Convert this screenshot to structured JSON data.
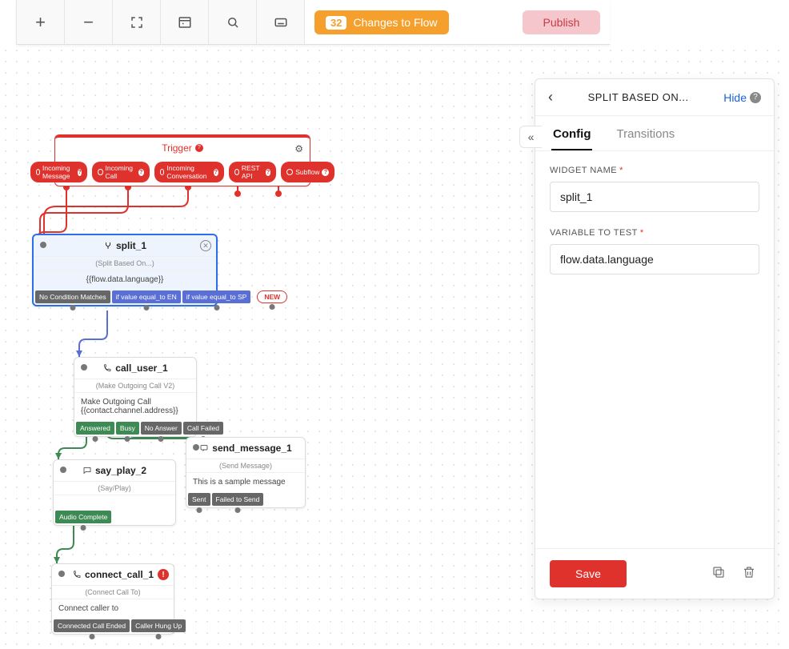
{
  "toolbar": {
    "changes_count": "32",
    "changes_label": "Changes to Flow",
    "publish_label": "Publish"
  },
  "trigger": {
    "title": "Trigger",
    "outputs": [
      "Incoming Message",
      "Incoming Call",
      "Incoming Conversation",
      "REST API",
      "Subflow"
    ]
  },
  "split_1": {
    "title": "split_1",
    "subtitle": "(Split Based On...)",
    "body": "{{flow.data.language}}",
    "outputs": {
      "no_match": "No Condition Matches",
      "en": "if value equal_to EN",
      "sp": "if value equal_to SP",
      "new": "NEW"
    }
  },
  "call_user_1": {
    "title": "call_user_1",
    "subtitle": "(Make Outgoing Call V2)",
    "body_line1": "Make Outgoing Call",
    "body_line2": "{{contact.channel.address}}",
    "outputs": {
      "answered": "Answered",
      "busy": "Busy",
      "noanswer": "No Answer",
      "callfailed": "Call Failed"
    }
  },
  "say_play_2": {
    "title": "say_play_2",
    "subtitle": "(Say/Play)",
    "outputs": {
      "audio": "Audio Complete"
    }
  },
  "send_message_1": {
    "title": "send_message_1",
    "subtitle": "(Send Message)",
    "body": "This is a sample message",
    "outputs": {
      "sent": "Sent",
      "failed": "Failed to Send"
    }
  },
  "connect_call_1": {
    "title": "connect_call_1",
    "subtitle": "(Connect Call To)",
    "body": "Connect caller to",
    "outputs": {
      "ended": "Connected Call Ended",
      "hangup": "Caller Hung Up"
    }
  },
  "panel": {
    "title": "SPLIT BASED ON...",
    "hide": "Hide",
    "tabs": {
      "config": "Config",
      "transitions": "Transitions"
    },
    "widget_name_label": "WIDGET NAME",
    "widget_name_value": "split_1",
    "variable_label": "VARIABLE TO TEST",
    "variable_value": "flow.data.language",
    "save": "Save"
  }
}
